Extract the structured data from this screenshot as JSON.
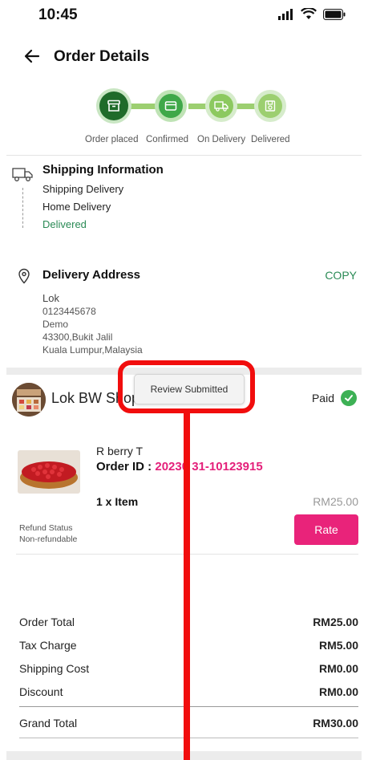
{
  "status_bar": {
    "time": "10:45"
  },
  "header": {
    "title": "Order Details"
  },
  "progress": {
    "steps": [
      {
        "label": "Order placed",
        "icon": "archive-box-icon",
        "state": "current"
      },
      {
        "label": "Confirmed",
        "icon": "card-icon",
        "state": "done"
      },
      {
        "label": "On Delivery",
        "icon": "truck-icon",
        "state": "done"
      },
      {
        "label": "Delivered",
        "icon": "box-icon",
        "state": "done"
      }
    ],
    "colors": {
      "dark": "#2e7d32",
      "mid": "#4caf50",
      "light": "#9ccf70"
    }
  },
  "shipping": {
    "title": "Shipping Information",
    "method": "Shipping Delivery",
    "type": "Home Delivery",
    "status": "Delivered"
  },
  "address": {
    "title": "Delivery Address",
    "copy_label": "COPY",
    "name": "Lok",
    "phone": "0123445678",
    "line1": "Demo",
    "line2": "43300,Bukit Jalil",
    "line3": "Kuala Lumpur,Malaysia"
  },
  "shop": {
    "name": "Lok BW Shop",
    "payment_status": "Paid"
  },
  "tooltip": {
    "text": "Review Submitted"
  },
  "product": {
    "name": "R berry T",
    "order_id_label": "Order ID :",
    "order_id": "20230 31-10123915",
    "qty": "1 x Item",
    "price": "RM25.00",
    "refund_label": "Refund Status",
    "refund_value": "Non-refundable",
    "rate_label": "Rate"
  },
  "summary": {
    "order_total_label": "Order Total",
    "order_total": "RM25.00",
    "tax_label": "Tax Charge",
    "tax": "RM5.00",
    "shipping_label": "Shipping Cost",
    "shipping": "RM0.00",
    "discount_label": "Discount",
    "discount": "RM0.00",
    "grand_total_label": "Grand Total",
    "grand_total": "RM30.00"
  },
  "accent": {
    "pink": "#e9237a",
    "annotation_red": "#f10d0d"
  }
}
